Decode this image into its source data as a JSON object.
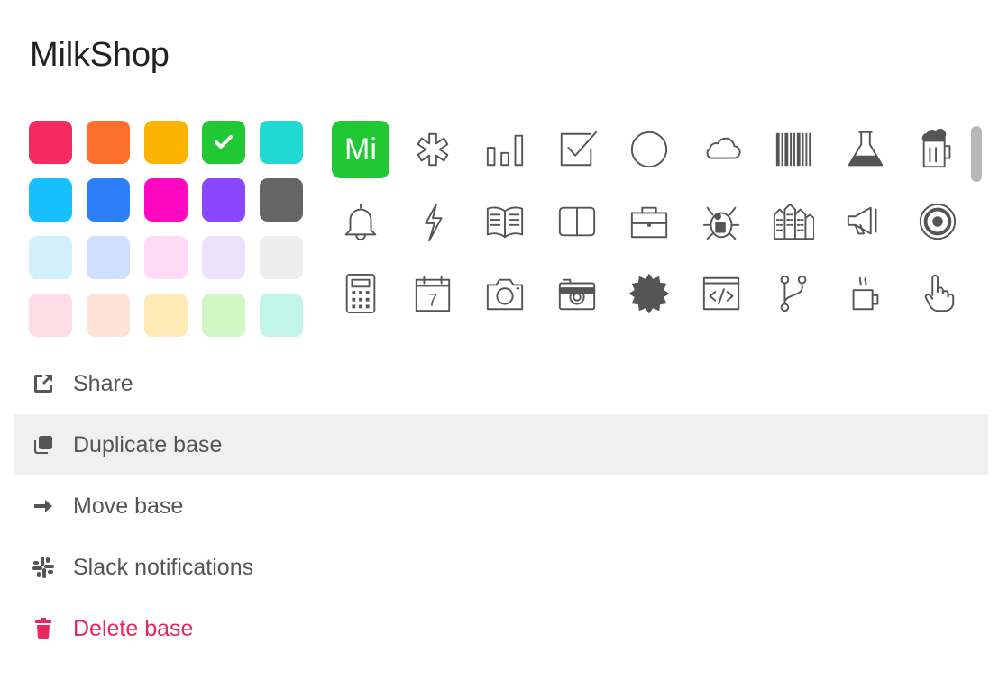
{
  "base": {
    "title": "MilkShop",
    "initials": "Mi",
    "selected_color": "#20c933",
    "selected_icon": "initials"
  },
  "colors": [
    {
      "name": "red",
      "hex": "#f82b60",
      "selected": false
    },
    {
      "name": "orange",
      "hex": "#ff6f2c",
      "selected": false
    },
    {
      "name": "yellow",
      "hex": "#fcb400",
      "selected": false
    },
    {
      "name": "green",
      "hex": "#20c933",
      "selected": true
    },
    {
      "name": "teal",
      "hex": "#20d9d2",
      "selected": false
    },
    {
      "name": "cyan",
      "hex": "#18bfff",
      "selected": false
    },
    {
      "name": "blue",
      "hex": "#2d7ff9",
      "selected": false
    },
    {
      "name": "pink",
      "hex": "#ff08c2",
      "selected": false
    },
    {
      "name": "purple",
      "hex": "#8b46ff",
      "selected": false
    },
    {
      "name": "gray",
      "hex": "#666666",
      "selected": false
    },
    {
      "name": "cyan-light",
      "hex": "#d0f0fd",
      "selected": false
    },
    {
      "name": "blue-light",
      "hex": "#cfdfff",
      "selected": false
    },
    {
      "name": "pink-light",
      "hex": "#ffdaf6",
      "selected": false
    },
    {
      "name": "purple-light",
      "hex": "#ede2fe",
      "selected": false
    },
    {
      "name": "gray-light",
      "hex": "#eeeeee",
      "selected": false
    },
    {
      "name": "red-light",
      "hex": "#ffdce5",
      "selected": false
    },
    {
      "name": "orange-light",
      "hex": "#fee2d5",
      "selected": false
    },
    {
      "name": "yellow-light",
      "hex": "#ffeab6",
      "selected": false
    },
    {
      "name": "green-light",
      "hex": "#d1f7c4",
      "selected": false
    },
    {
      "name": "teal-light",
      "hex": "#c2f5e9",
      "selected": false
    }
  ],
  "icons": [
    "initials",
    "asterisk-icon",
    "bar-chart-icon",
    "checkbox-icon",
    "circle-icon",
    "cloud-icon",
    "barcode-icon",
    "flask-icon",
    "beer-icon",
    "bell-icon",
    "bolt-icon",
    "open-book-icon",
    "book-icon",
    "briefcase-icon",
    "bug-icon",
    "buildings-icon",
    "megaphone-icon",
    "target-icon",
    "calculator-icon",
    "calendar-icon",
    "camera-icon",
    "camera-retro-icon",
    "certificate-icon",
    "code-icon",
    "git-branch-icon",
    "coffee-icon",
    "hand-pointer-icon"
  ],
  "calendar_day": "7",
  "menu": [
    {
      "key": "share",
      "label": "Share",
      "icon": "share-icon",
      "hover": false,
      "danger": false
    },
    {
      "key": "duplicate",
      "label": "Duplicate base",
      "icon": "duplicate-icon",
      "hover": true,
      "danger": false
    },
    {
      "key": "move",
      "label": "Move base",
      "icon": "arrow-right-icon",
      "hover": false,
      "danger": false
    },
    {
      "key": "slack",
      "label": "Slack notifications",
      "icon": "slack-icon",
      "hover": false,
      "danger": false
    },
    {
      "key": "delete",
      "label": "Delete base",
      "icon": "trash-icon",
      "hover": false,
      "danger": true
    }
  ],
  "theme": {
    "icon_color": "#555555",
    "danger_color": "#e8265c",
    "hover_bg": "#f0f0f0"
  }
}
